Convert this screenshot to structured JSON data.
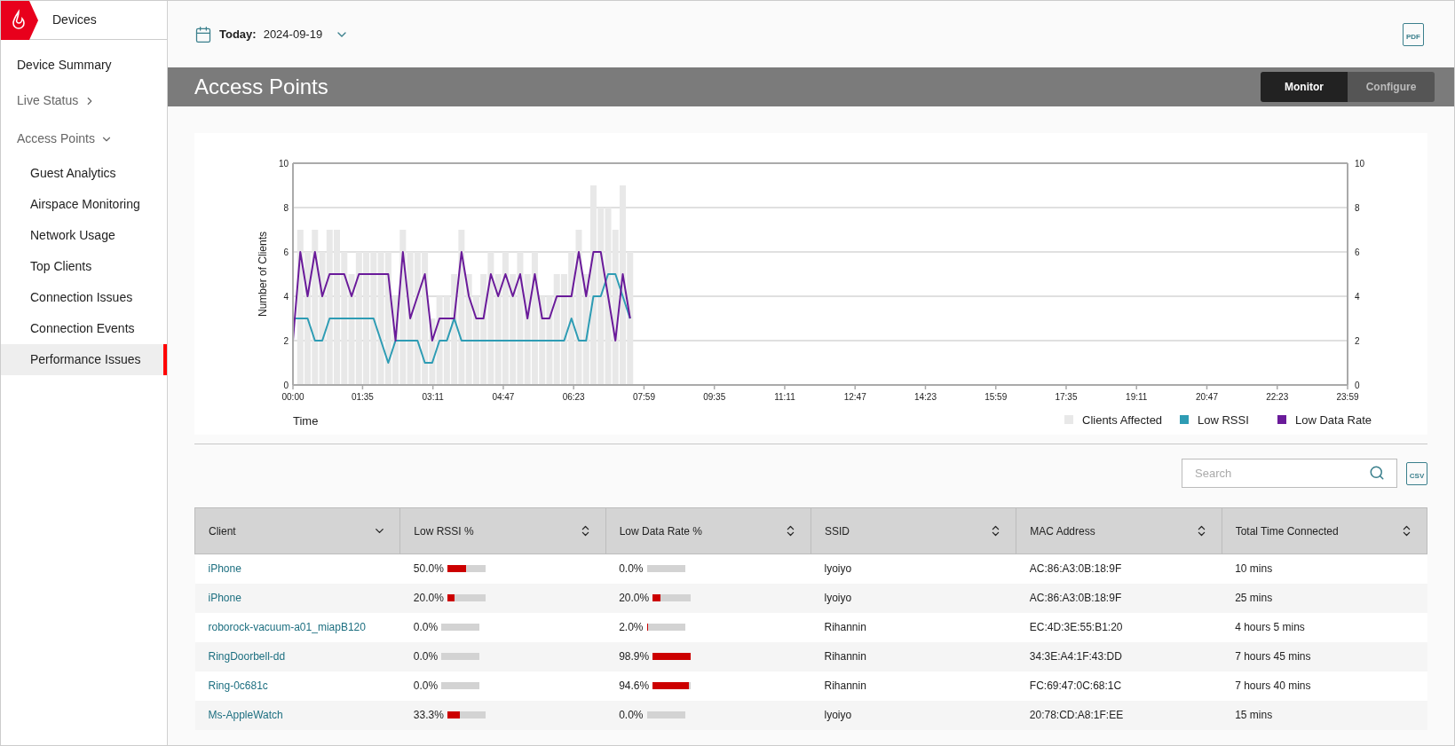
{
  "app": {
    "section": "Devices"
  },
  "sidebar": {
    "items": [
      {
        "label": "Device Summary",
        "kind": "link",
        "selected": false
      },
      {
        "label": "Live Status",
        "kind": "group",
        "expanded": false
      },
      {
        "label": "Access Points",
        "kind": "group",
        "expanded": true,
        "children": [
          {
            "label": "Guest Analytics",
            "selected": false
          },
          {
            "label": "Airspace Monitoring",
            "selected": false
          },
          {
            "label": "Network Usage",
            "selected": false
          },
          {
            "label": "Top Clients",
            "selected": false
          },
          {
            "label": "Connection Issues",
            "selected": false
          },
          {
            "label": "Connection Events",
            "selected": false
          },
          {
            "label": "Performance Issues",
            "selected": true
          }
        ]
      }
    ]
  },
  "date_picker": {
    "label": "Today:",
    "value": "2024-09-19"
  },
  "export_button": {
    "label": "PDF"
  },
  "page_title": "Access Points",
  "mode_tabs": [
    {
      "label": "Monitor",
      "selected": true
    },
    {
      "label": "Configure",
      "selected": false
    }
  ],
  "chart_data": {
    "type": "line",
    "xlabel": "Time",
    "ylabel": "Number of Clients",
    "x": [
      0,
      0.167,
      0.333,
      0.5,
      0.667,
      0.833,
      1,
      1.167,
      1.333,
      1.5,
      1.667,
      1.833,
      2,
      2.167,
      2.333,
      2.5,
      2.667,
      2.833,
      3,
      3.167,
      3.333,
      3.5,
      3.667,
      3.833,
      4,
      4.167,
      4.333,
      4.5,
      4.667,
      4.833,
      5,
      5.167,
      5.333,
      5.5,
      5.667,
      5.833,
      6,
      6.167,
      6.333,
      6.5,
      6.667,
      6.833,
      7,
      7.167,
      7.333,
      7.5,
      7.667
    ],
    "series": [
      {
        "name": "Clients Affected",
        "type": "bar",
        "color": "#e8e8e8",
        "values": [
          null,
          7,
          6,
          7,
          6,
          7,
          7,
          6,
          5,
          6,
          6,
          6,
          6,
          6,
          4,
          7,
          6,
          6,
          6,
          3,
          4,
          4,
          5,
          7,
          5,
          4,
          5,
          6,
          5,
          6,
          5,
          6,
          5,
          6,
          4,
          4,
          5,
          5,
          6,
          7,
          5,
          9,
          8,
          8,
          7,
          9,
          6
        ]
      },
      {
        "name": "Low RSSI",
        "color": "#2e9cb4",
        "values": [
          3,
          3,
          3,
          2,
          2,
          3,
          3,
          3,
          3,
          3,
          3,
          3,
          2,
          1,
          2,
          2,
          2,
          2,
          1,
          1,
          2,
          2,
          3,
          2,
          2,
          2,
          2,
          2,
          2,
          2,
          2,
          2,
          2,
          2,
          2,
          2,
          2,
          2,
          3,
          2,
          2,
          4,
          4,
          5,
          5,
          4,
          3
        ]
      },
      {
        "name": "Low Data Rate",
        "color": "#6a1b9a",
        "values": [
          2,
          6,
          4,
          6,
          4,
          5,
          5,
          5,
          4,
          5,
          5,
          5,
          5,
          5,
          2,
          6,
          3,
          4,
          5,
          2,
          3,
          3,
          3,
          6,
          4,
          3,
          3,
          5,
          4,
          5,
          4,
          5,
          3,
          5,
          3,
          3,
          4,
          4,
          4,
          6,
          4,
          6,
          6,
          4,
          2,
          5,
          3
        ]
      }
    ],
    "xlim": [
      0,
      23.983
    ],
    "ylim": [
      0,
      10
    ],
    "xticks": [
      {
        "value": 0,
        "label": "00:00"
      },
      {
        "value": 1.583,
        "label": "01:35"
      },
      {
        "value": 3.183,
        "label": "03:11"
      },
      {
        "value": 4.783,
        "label": "04:47"
      },
      {
        "value": 6.383,
        "label": "06:23"
      },
      {
        "value": 7.983,
        "label": "07:59"
      },
      {
        "value": 9.583,
        "label": "09:35"
      },
      {
        "value": 11.183,
        "label": "11:11"
      },
      {
        "value": 12.783,
        "label": "12:47"
      },
      {
        "value": 14.383,
        "label": "14:23"
      },
      {
        "value": 15.983,
        "label": "15:59"
      },
      {
        "value": 17.583,
        "label": "17:35"
      },
      {
        "value": 19.183,
        "label": "19:11"
      },
      {
        "value": 20.783,
        "label": "20:47"
      },
      {
        "value": 22.383,
        "label": "22:23"
      },
      {
        "value": 23.983,
        "label": "23:59"
      }
    ],
    "yticks": [
      0,
      2,
      4,
      6,
      8,
      10
    ],
    "grid": true,
    "legend": true
  },
  "chart_right_axis": {
    "ticks": [
      "10",
      "8",
      "6",
      "4",
      "2",
      "0"
    ]
  },
  "search": {
    "placeholder": "Search"
  },
  "csv_button": {
    "label": "CSV"
  },
  "table": {
    "columns": [
      {
        "label": "Client",
        "sorted": true
      },
      {
        "label": "Low RSSI %",
        "sorted": false
      },
      {
        "label": "Low Data Rate %",
        "sorted": false
      },
      {
        "label": "SSID",
        "sorted": false
      },
      {
        "label": "MAC Address",
        "sorted": false
      },
      {
        "label": "Total Time Connected",
        "sorted": false
      }
    ],
    "rows": [
      {
        "client": "iPhone",
        "low_rssi": {
          "text": "50.0%",
          "level": 0.5
        },
        "low_data_rate": {
          "text": "0.0%",
          "level": 0
        },
        "ssid": "lyoiyo",
        "mac": "AC:86:A3:0B:18:9F",
        "time": "10 mins"
      },
      {
        "client": "iPhone",
        "low_rssi": {
          "text": "20.0%",
          "level": 0.2
        },
        "low_data_rate": {
          "text": "20.0%",
          "level": 0.2
        },
        "ssid": "lyoiyo",
        "mac": "AC:86:A3:0B:18:9F",
        "time": "25 mins"
      },
      {
        "client": "roborock-vacuum-a01_miapB120",
        "low_rssi": {
          "text": "0.0%",
          "level": 0
        },
        "low_data_rate": {
          "text": "2.0%",
          "level": 0.02
        },
        "ssid": "Rihannin",
        "mac": "EC:4D:3E:55:B1:20",
        "time": "4 hours 5 mins"
      },
      {
        "client": "RingDoorbell-dd",
        "low_rssi": {
          "text": "0.0%",
          "level": 0
        },
        "low_data_rate": {
          "text": "98.9%",
          "level": 0.989
        },
        "ssid": "Rihannin",
        "mac": "34:3E:A4:1F:43:DD",
        "time": "7 hours 45 mins"
      },
      {
        "client": "Ring-0c681c",
        "low_rssi": {
          "text": "0.0%",
          "level": 0
        },
        "low_data_rate": {
          "text": "94.6%",
          "level": 0.946
        },
        "ssid": "Rihannin",
        "mac": "FC:69:47:0C:68:1C",
        "time": "7 hours 40 mins"
      },
      {
        "client": "Ms-AppleWatch",
        "low_rssi": {
          "text": "33.3%",
          "level": 0.333
        },
        "low_data_rate": {
          "text": "0.0%",
          "level": 0
        },
        "ssid": "lyoiyo",
        "mac": "20:78:CD:A8:1F:EE",
        "time": "15 mins"
      }
    ]
  }
}
